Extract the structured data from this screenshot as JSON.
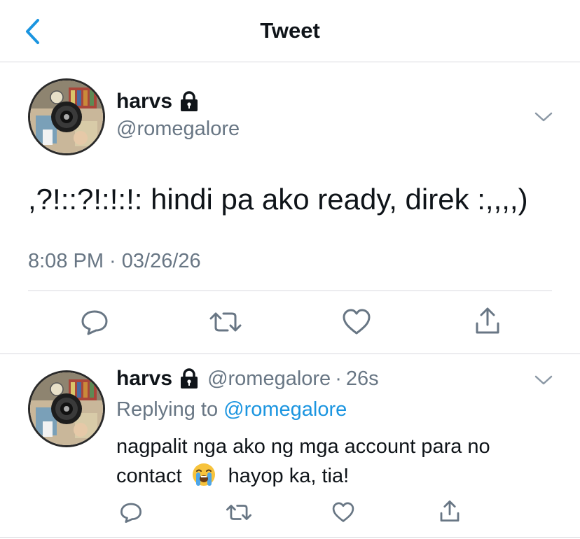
{
  "header": {
    "title": "Tweet",
    "back_icon": "chevron-left-icon",
    "accent": "#1b95e0"
  },
  "main_tweet": {
    "name": "harvs",
    "handle": "@romegalore",
    "text": ",?!::?!:!:!: hindi pa ako ready, direk :,,,,)",
    "timestamp": "8:08 PM · 03/26/26",
    "locked": true
  },
  "reply_tweet": {
    "name": "harvs",
    "handle": "@romegalore",
    "separator": "·",
    "time": "26s",
    "replying_prefix": "Replying to",
    "replying_to": "@romegalore",
    "text_before_emoji": "nagpalit nga ako ng mga account para no contact",
    "emoji": "loudly-crying-face",
    "text_after_emoji": "hayop ka, tia!"
  },
  "actions": [
    "reply-icon",
    "retweet-icon",
    "like-icon",
    "share-icon"
  ],
  "colors": {
    "text": "#0f1419",
    "secondary": "#687684",
    "link": "#1b95e0",
    "divider": "#d9d9de"
  }
}
